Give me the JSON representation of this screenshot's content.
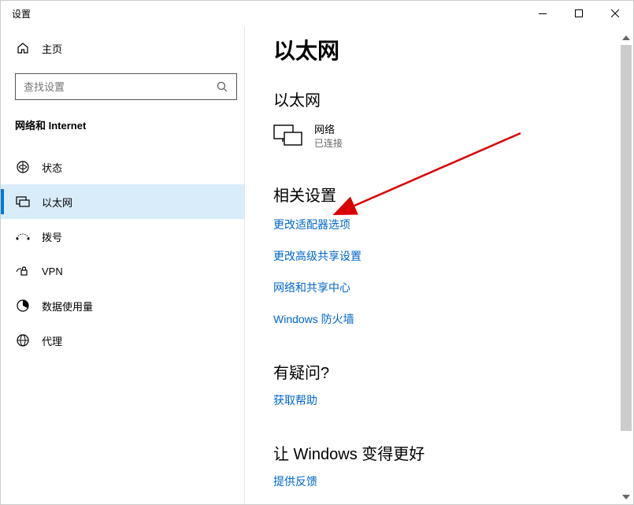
{
  "window": {
    "title": "设置"
  },
  "sidebar": {
    "home": "主页",
    "search_placeholder": "查找设置",
    "section": "网络和 Internet",
    "items": [
      {
        "label": "状态",
        "active": false
      },
      {
        "label": "以太网",
        "active": true
      },
      {
        "label": "拨号",
        "active": false
      },
      {
        "label": "VPN",
        "active": false
      },
      {
        "label": "数据使用量",
        "active": false
      },
      {
        "label": "代理",
        "active": false
      }
    ]
  },
  "main": {
    "title": "以太网",
    "subsection": "以太网",
    "ethernet": {
      "name": "网络",
      "status": "已连接"
    },
    "related": {
      "title": "相关设置",
      "links": [
        "更改适配器选项",
        "更改高级共享设置",
        "网络和共享中心",
        "Windows 防火墙"
      ]
    },
    "help": {
      "title": "有疑问?",
      "link": "获取帮助"
    },
    "feedback": {
      "title": "让 Windows 变得更好",
      "link": "提供反馈"
    }
  }
}
